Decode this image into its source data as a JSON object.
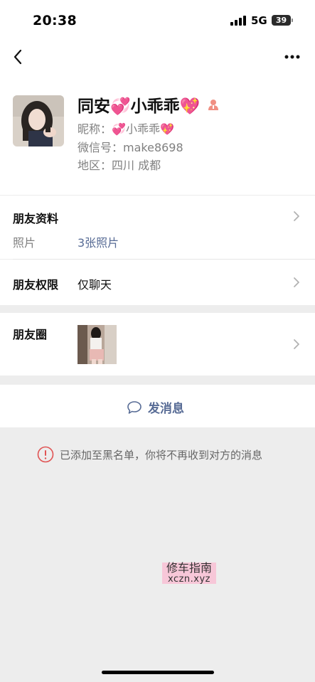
{
  "status": {
    "time": "20:38",
    "network": "5G",
    "battery": "39"
  },
  "profile": {
    "display_name": "同安💞小乖乖💖",
    "nickname_label": "昵称：",
    "nickname": "💞小乖乖💖",
    "wechat_id_label": "微信号：",
    "wechat_id": "make8698",
    "region_label": "地区：",
    "region": "四川 成都"
  },
  "friend_info": {
    "title": "朋友资料",
    "photos_label": "照片",
    "photos_value": "3张照片"
  },
  "permissions": {
    "title": "朋友权限",
    "value": "仅聊天"
  },
  "moments": {
    "title": "朋友圈"
  },
  "actions": {
    "send_message": "发消息"
  },
  "notice": {
    "text": "已添加至黑名单，你将不再收到对方的消息"
  },
  "watermark": {
    "line1": "修车指南",
    "line2": "xczn.xyz"
  },
  "colors": {
    "link": "#576b95",
    "warning": "#e05353",
    "background": "#ededed"
  },
  "icons": [
    "back-icon",
    "more-icon",
    "gender-icon",
    "chevron-right-icon",
    "chat-bubble-icon",
    "warning-icon"
  ]
}
